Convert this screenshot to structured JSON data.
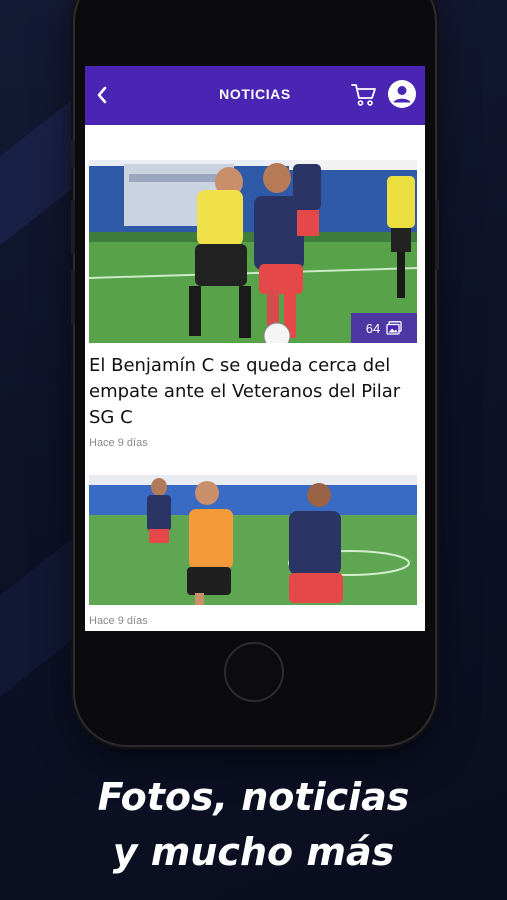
{
  "header": {
    "title": "NOTICIAS",
    "back_icon": "chevron-left-icon",
    "cart_icon": "cart-icon",
    "profile_icon": "user-avatar-icon"
  },
  "articles": [
    {
      "headline": "El Benjamín C se queda cerca del empate ante el Veteranos del Pilar SG C",
      "time": "Hace 9 días",
      "photo_count": "64",
      "gallery_icon": "image-gallery-icon"
    },
    {
      "headline": "",
      "time": "Hace 9 días"
    }
  ],
  "tagline": {
    "line1": "Fotos, noticias",
    "line2": "y mucho más"
  },
  "colors": {
    "brand": "#4a24b3",
    "background": "#0d1228"
  }
}
